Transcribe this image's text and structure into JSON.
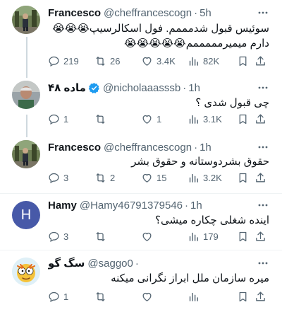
{
  "tweets": [
    {
      "name": "Francesco",
      "handle": "@cheffrancescogn",
      "time": "5h",
      "line1": "سوئیس قبول شدمممم. فول اسکالرسیپ",
      "line1_emoji": "😭😭😭",
      "line2": "دارم میمیرمممممم",
      "line2_emoji": "😭😭😭😭😭",
      "replies": "219",
      "retweets": "26",
      "likes": "3.4K",
      "views": "82K"
    },
    {
      "name": "ماده ۴۸",
      "handle": "@nicholaaasssb",
      "time": "1h",
      "line1": "چی قبول شدی ؟",
      "replies": "1",
      "retweets": "",
      "likes": "1",
      "views": "3.1K"
    },
    {
      "name": "Francesco",
      "handle": "@cheffrancescogn",
      "time": "1h",
      "line1": "حقوق بشردوستانه و حقوق بشر",
      "replies": "3",
      "retweets": "2",
      "likes": "15",
      "views": "3.2K"
    },
    {
      "name": "Hamy",
      "handle": "@Hamy46791379546",
      "time": "1h",
      "avatar_letter": "H",
      "line1": "اینده شغلی چکاره میشی؟",
      "replies": "3",
      "retweets": "",
      "likes": "",
      "views": "179"
    },
    {
      "name": "سگ گو",
      "handle": "@saggo0",
      "handle_tail": "·",
      "line1": "میره سازمان ملل ابراز نگرانی میکنه",
      "replies": "1",
      "retweets": "",
      "likes": "",
      "views": ""
    }
  ],
  "colors": {
    "text": "#0f1419",
    "secondary": "#536471",
    "verified": "#1d9bf0",
    "avatar_hamy": "#4759a8",
    "divider": "#eff3f4",
    "thread_line": "#cfd9de"
  }
}
